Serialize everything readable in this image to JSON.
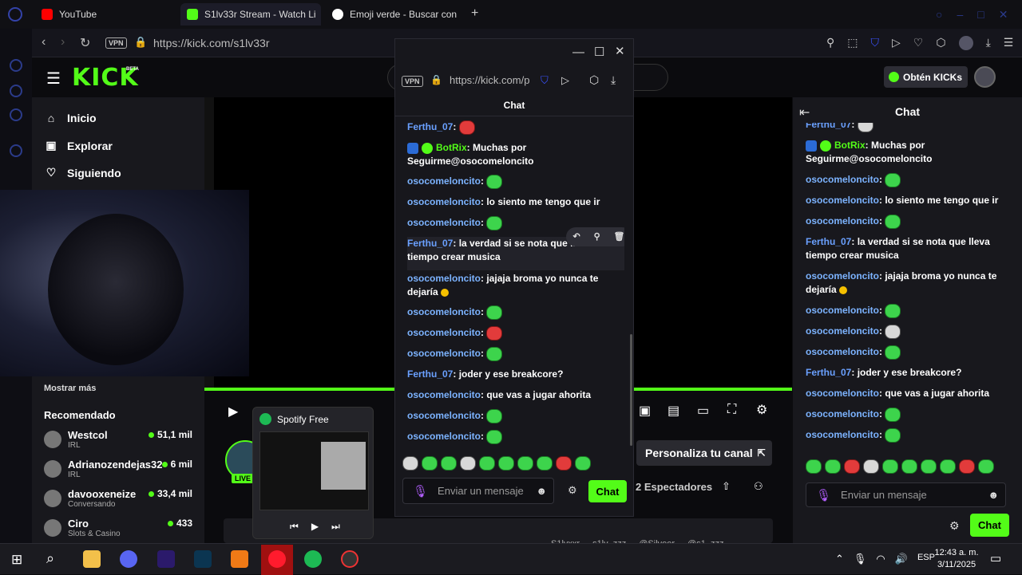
{
  "browser": {
    "tabs": [
      {
        "label": "YouTube",
        "color": "#ff0000"
      },
      {
        "label": "S1lv33r Stream - Watch Li",
        "color": "#53fc18"
      },
      {
        "label": "Emoji verde - Buscar con",
        "color": "#4285f4"
      }
    ],
    "new_tab": "+",
    "vpn": "VPN",
    "url": "https://kick.com/s1lv33r"
  },
  "kick": {
    "logo": "KICK",
    "logo_sup": "BETA",
    "get_kicks": "Obtén KICKs",
    "accent": "#53fc18"
  },
  "sidebar": {
    "nav": [
      {
        "label": "Inicio",
        "icon": "home-icon"
      },
      {
        "label": "Explorar",
        "icon": "compass-icon"
      },
      {
        "label": "Siguiendo",
        "icon": "heart-icon"
      }
    ],
    "show_more": "Mostrar más",
    "recommended_title": "Recomendado",
    "recommended": [
      {
        "name": "Westcol",
        "category": "IRL",
        "viewers": "51,1 mil"
      },
      {
        "name": "Adrianozendejas32",
        "category": "IRL",
        "viewers": "6 mil"
      },
      {
        "name": "davooxeneize",
        "category": "Conversando",
        "viewers": "33,4 mil"
      },
      {
        "name": "Ciro",
        "category": "Slots & Casino",
        "viewers": "433"
      }
    ]
  },
  "popup": {
    "vpn": "VPN",
    "url": "https://kick.com/p",
    "chat_title": "Chat",
    "messages": [
      {
        "user": "Ferthu_07",
        "text": ":",
        "emote": "red"
      },
      {
        "user": "BotRix",
        "text": ": Muchas por Seguirme@osocomeloncito",
        "badges": true
      },
      {
        "user": "osocomeloncito",
        "text": ":",
        "emote": "green"
      },
      {
        "user": "osocomeloncito",
        "text": ": lo siento me tengo que ir"
      },
      {
        "user": "osocomeloncito",
        "text": ":",
        "emote": "green"
      },
      {
        "user": "Ferthu_07",
        "text": ": la verdad si se nota que lleva tiempo crear musica"
      },
      {
        "user": "osocomeloncito",
        "text": ": jajaja broma yo nunca te dejaría",
        "emote": "yel"
      },
      {
        "user": "osocomeloncito",
        "text": ":",
        "emote": "green"
      },
      {
        "user": "osocomeloncito",
        "text": ":",
        "emote": "red"
      },
      {
        "user": "osocomeloncito",
        "text": ":",
        "emote": "green"
      },
      {
        "user": "Ferthu_07",
        "text": ": joder y ese breakcore?"
      },
      {
        "user": "osocomeloncito",
        "text": ": que vas a jugar ahorita"
      },
      {
        "user": "osocomeloncito",
        "text": ":",
        "emote": "green"
      },
      {
        "user": "osocomeloncito",
        "text": ":",
        "emote": "green"
      }
    ],
    "input_placeholder": "Enviar un mensaje",
    "send": "Chat"
  },
  "right_chat": {
    "title": "Chat",
    "messages": [
      {
        "user": "Ferthu_07",
        "text": ":"
      },
      {
        "user": "BotRix",
        "text": ": Muchas por Seguirme@osocomeloncito"
      },
      {
        "user": "osocomeloncito",
        "text": ":"
      },
      {
        "user": "osocomeloncito",
        "text": ": lo siento me tengo que ir"
      },
      {
        "user": "osocomeloncito",
        "text": ":"
      },
      {
        "user": "Ferthu_07",
        "text": ": la verdad si se nota que lleva tiempo crear musica"
      },
      {
        "user": "osocomeloncito",
        "text": ": jajaja broma yo nunca te dejaría"
      },
      {
        "user": "osocomeloncito",
        "text": ":"
      },
      {
        "user": "osocomeloncito",
        "text": ":"
      },
      {
        "user": "osocomeloncito",
        "text": ":"
      },
      {
        "user": "Ferthu_07",
        "text": ": joder y ese breakcore?"
      },
      {
        "user": "osocomeloncito",
        "text": ": que vas a jugar ahorita"
      },
      {
        "user": "osocomeloncito",
        "text": ":"
      },
      {
        "user": "osocomeloncito",
        "text": ":"
      }
    ],
    "input_placeholder": "Enviar un mensaje",
    "send": "Chat"
  },
  "channel": {
    "customize": "Personaliza tu canal",
    "viewers": "2 Espectadores",
    "live": "LIVE",
    "socials": [
      "S1lvxxr",
      "s1lv_zzz",
      "@Silveer",
      "@s1_zzz"
    ]
  },
  "spotify": {
    "title": "Spotify Free"
  },
  "taskbar": {
    "lang": "ESP",
    "time": "12:43 a. m.",
    "date": "3/11/2025"
  }
}
